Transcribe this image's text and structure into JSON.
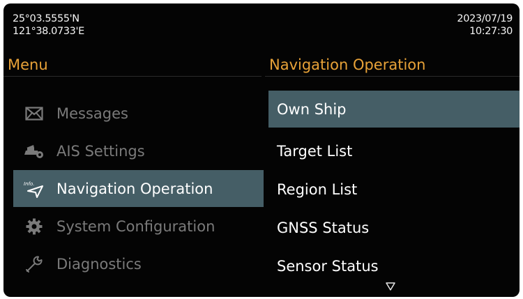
{
  "status": {
    "latitude": "25°03.5555'N",
    "longitude": "121°38.0733'E",
    "date": "2023/07/19",
    "time": "10:27:30"
  },
  "menu": {
    "title": "Menu",
    "items": [
      {
        "label": "Messages",
        "icon": "envelope-icon",
        "active": false
      },
      {
        "label": "AIS Settings",
        "icon": "ais-settings-icon",
        "active": false
      },
      {
        "label": "Navigation Operation",
        "icon": "info-navigation-icon",
        "active": true
      },
      {
        "label": "System Configuration",
        "icon": "gear-icon",
        "active": false
      },
      {
        "label": "Diagnostics",
        "icon": "wrench-icon",
        "active": false
      }
    ]
  },
  "navigation": {
    "title": "Navigation Operation",
    "items": [
      {
        "label": "Own Ship",
        "selected": true
      },
      {
        "label": "Target List",
        "selected": false
      },
      {
        "label": "Region List",
        "selected": false
      },
      {
        "label": "GNSS Status",
        "selected": false
      },
      {
        "label": "Sensor Status",
        "selected": false
      }
    ],
    "more_indicator": "chevron-down-icon"
  },
  "colors": {
    "background": "#040404",
    "accent_title": "#e8a238",
    "highlight": "#455e66",
    "inactive_text": "#7a7a7a"
  }
}
